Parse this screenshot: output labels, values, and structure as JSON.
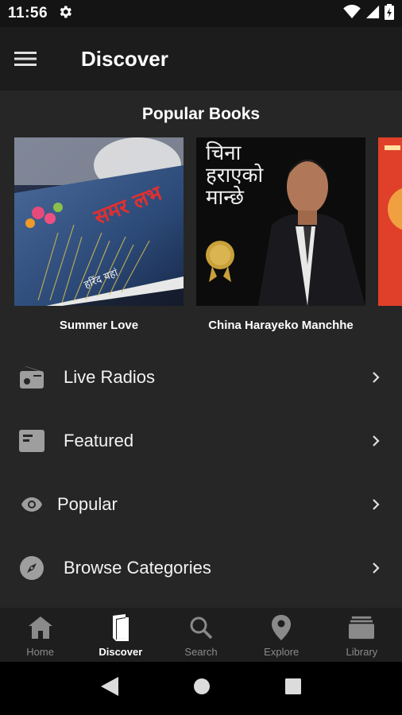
{
  "status": {
    "time": "11:56"
  },
  "appbar": {
    "title": "Discover"
  },
  "section": {
    "title": "Popular Books"
  },
  "books": [
    {
      "title": "Summer Love",
      "cover_text": "समर लभ",
      "cover_author": "हरिंद यहां"
    },
    {
      "title": "China Harayeko Manchhe",
      "cover_text_line1": "चिना",
      "cover_text_line2": "हराएको",
      "cover_text_line3": "मान्छे"
    },
    {
      "title": "",
      "cover_text": ""
    }
  ],
  "menu": [
    {
      "label": "Live Radios",
      "icon": "radio-icon"
    },
    {
      "label": "Featured",
      "icon": "featured-icon"
    },
    {
      "label": "Popular",
      "icon": "eye-icon"
    },
    {
      "label": "Browse Categories",
      "icon": "compass-icon"
    }
  ],
  "bottom_nav": [
    {
      "label": "Home",
      "icon": "home-icon",
      "active": false
    },
    {
      "label": "Discover",
      "icon": "book-icon",
      "active": true
    },
    {
      "label": "Search",
      "icon": "search-icon",
      "active": false
    },
    {
      "label": "Explore",
      "icon": "location-pin-icon",
      "active": false
    },
    {
      "label": "Library",
      "icon": "library-icon",
      "active": false
    }
  ],
  "colors": {
    "background": "#262626",
    "app_bar": "#1c1c1c",
    "status_bar": "#141414",
    "bottom_nav": "#1e1e1e",
    "inactive_nav": "#8a8a8a",
    "active_nav": "#ffffff"
  }
}
